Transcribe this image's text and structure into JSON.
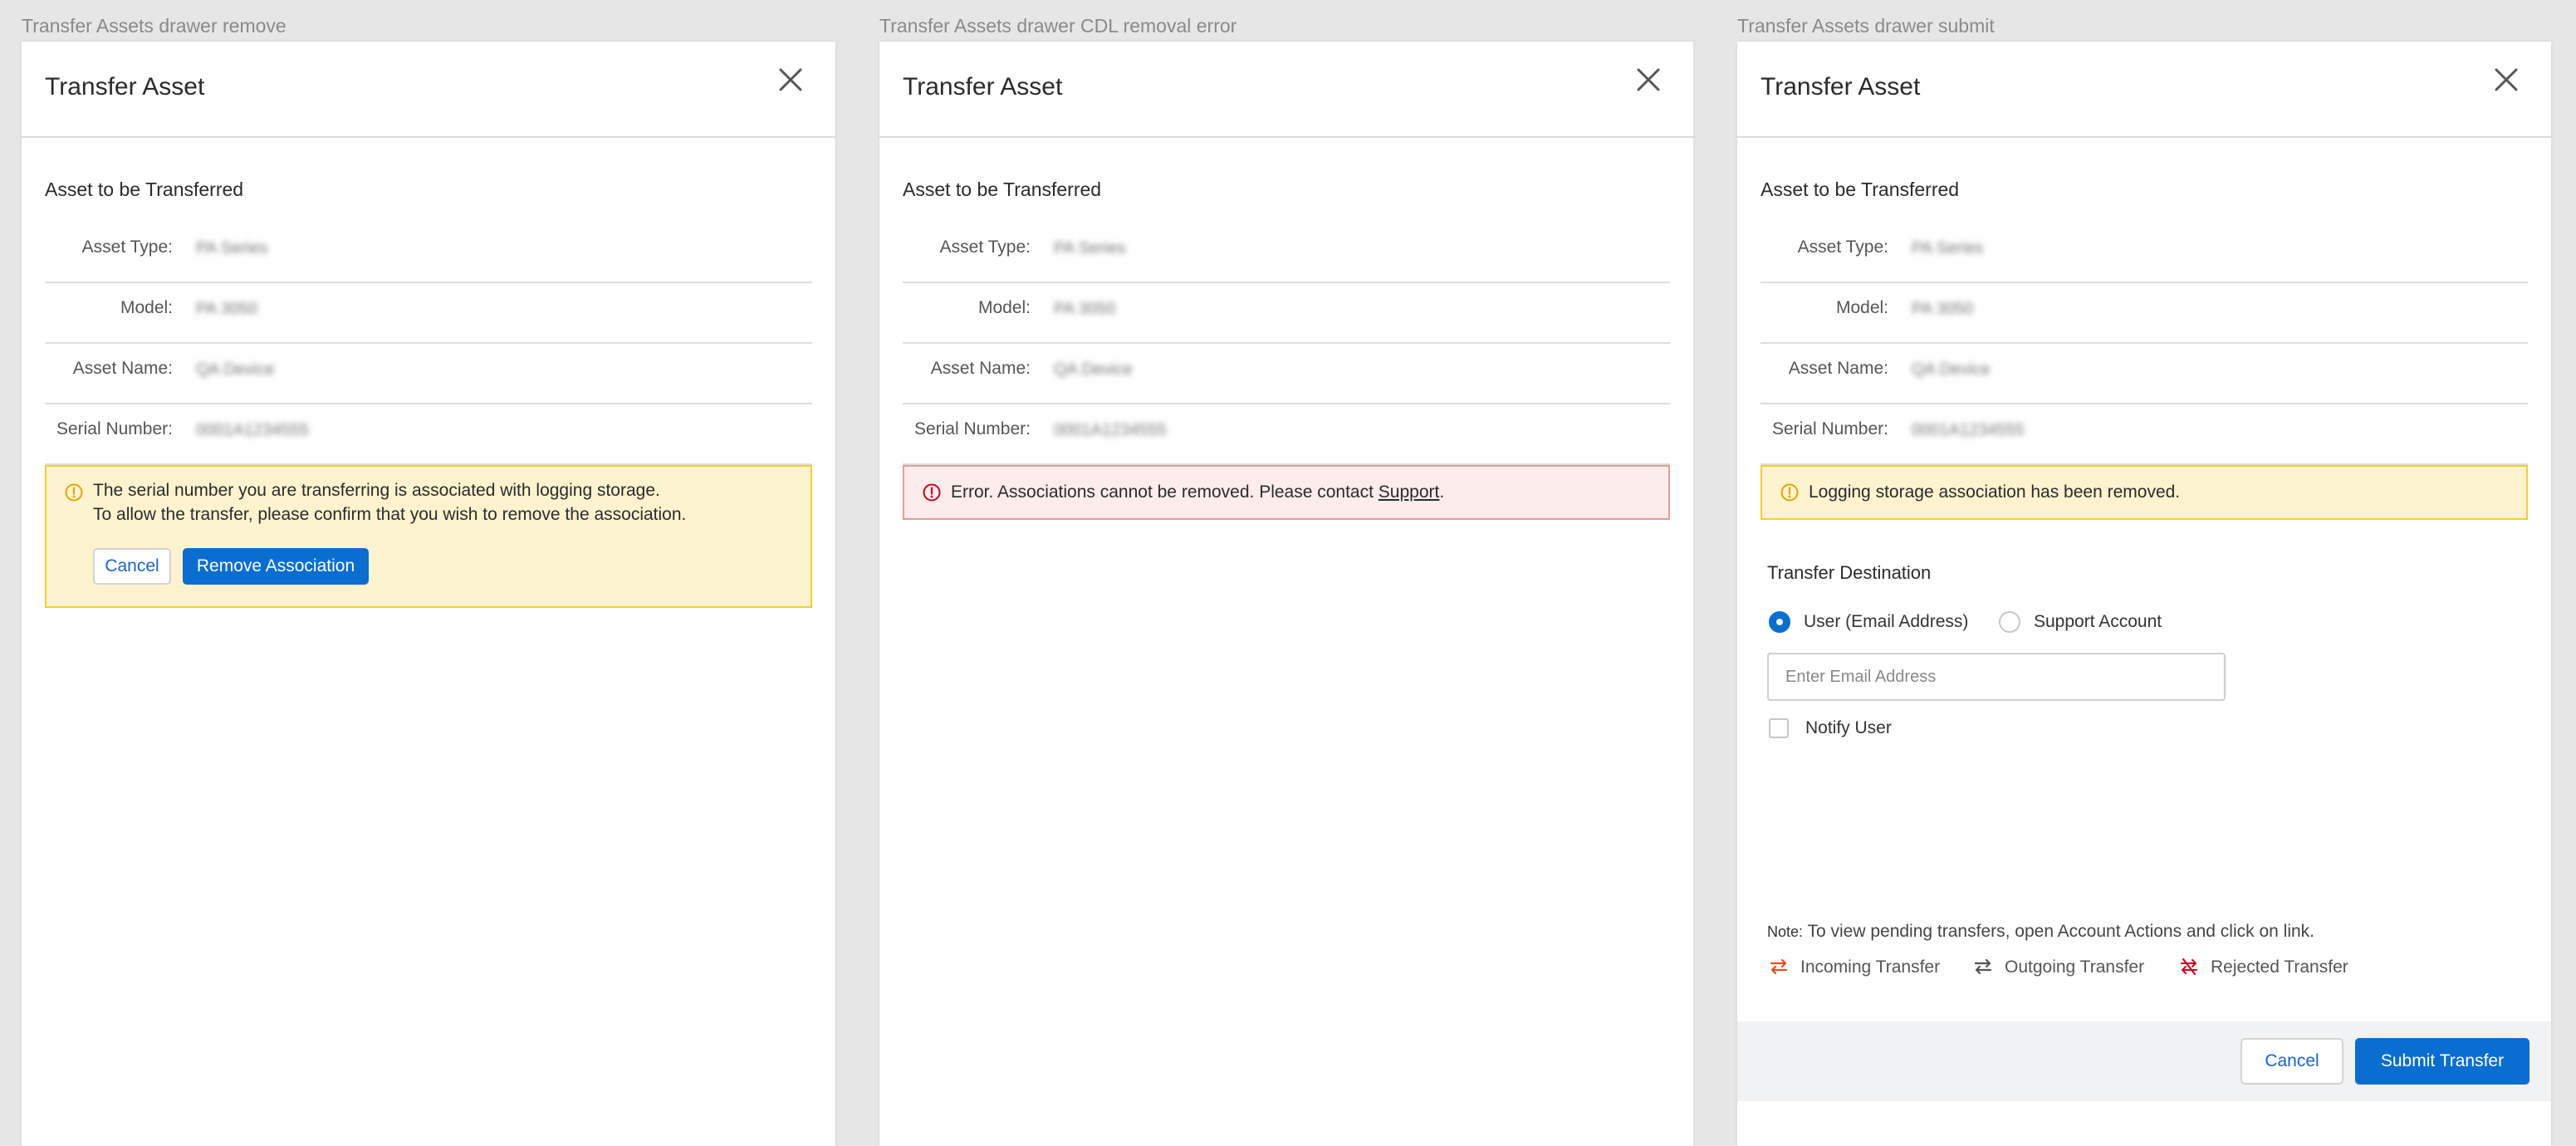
{
  "panels": [
    {
      "caption": "Transfer Assets drawer remove",
      "title": "Transfer Asset",
      "section_title": "Asset to be Transferred",
      "fields": [
        {
          "label": "Asset Type:",
          "value": "PA Series"
        },
        {
          "label": "Model:",
          "value": "PA 3050"
        },
        {
          "label": "Asset Name:",
          "value": "QA Device"
        },
        {
          "label": "Serial Number:",
          "value": "0001A1234555"
        }
      ],
      "alert": {
        "line1": "The serial number you are transferring is associated with logging storage.",
        "line2": "To allow the transfer, please confirm that you wish to remove the association.",
        "cancel_label": "Cancel",
        "remove_label": "Remove Association"
      }
    },
    {
      "caption": "Transfer Assets drawer CDL removal error",
      "title": "Transfer Asset",
      "section_title": "Asset to be Transferred",
      "fields": [
        {
          "label": "Asset Type:",
          "value": "PA Series"
        },
        {
          "label": "Model:",
          "value": "PA 3050"
        },
        {
          "label": "Asset Name:",
          "value": "QA Device"
        },
        {
          "label": "Serial Number:",
          "value": "0001A1234555"
        }
      ],
      "error": {
        "text": "Error. Associations cannot be removed. Please contact ",
        "link": "Support",
        "suffix": "."
      }
    },
    {
      "caption": "Transfer Assets drawer submit",
      "title": "Transfer Asset",
      "section_title": "Asset to be Transferred",
      "fields": [
        {
          "label": "Asset Type:",
          "value": "PA Series"
        },
        {
          "label": "Model:",
          "value": "PA 3050"
        },
        {
          "label": "Asset Name:",
          "value": "QA Device"
        },
        {
          "label": "Serial Number:",
          "value": "0001A1234555"
        }
      ],
      "notice": "Logging storage association has been removed.",
      "destination": {
        "title": "Transfer Destination",
        "option_user": "User (Email Address)",
        "option_support": "Support Account",
        "selected": "user",
        "email_placeholder": "Enter Email Address",
        "email_value": "",
        "notify_label": "Notify User",
        "notify_checked": false
      },
      "note": {
        "prefix": "Note:",
        "text": " To view pending transfers, open Account Actions and click on link."
      },
      "legend": [
        {
          "label": "Incoming Transfer",
          "icon": "incoming-transfer-icon",
          "color": "#e8501e"
        },
        {
          "label": "Outgoing Transfer",
          "icon": "outgoing-transfer-icon",
          "color": "#555555"
        },
        {
          "label": "Rejected Transfer",
          "icon": "rejected-transfer-icon",
          "color": "#d0021b"
        }
      ],
      "footer": {
        "cancel_label": "Cancel",
        "submit_label": "Submit Transfer"
      }
    }
  ],
  "colors": {
    "primary": "#0a6ed1",
    "warning_bg": "#fdf3cf",
    "warning_border": "#f3cf2e",
    "error_bg": "#fdecec",
    "error_border": "#e99a9a",
    "error_icon": "#d0021b",
    "warning_icon": "#e0a800"
  }
}
